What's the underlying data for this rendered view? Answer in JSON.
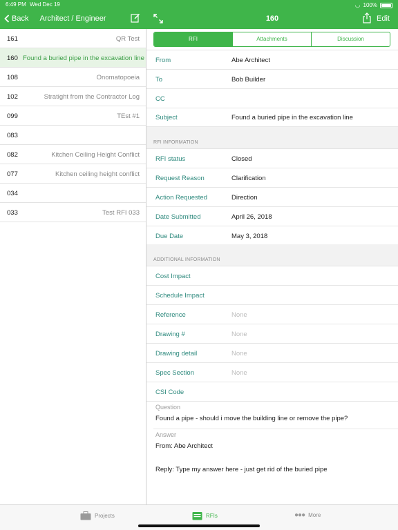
{
  "status_bar": {
    "time": "6:49 PM",
    "date": "Wed Dec 19",
    "battery": "100%"
  },
  "left_nav": {
    "back_label": "Back",
    "title": "Architect / Engineer"
  },
  "right_nav": {
    "title": "160",
    "edit_label": "Edit"
  },
  "rfi_list": [
    {
      "number": "161",
      "subject": "QR Test"
    },
    {
      "number": "160",
      "subject": "Found a buried pipe in the excavation line",
      "selected": true
    },
    {
      "number": "108",
      "subject": "Onomatopoeia"
    },
    {
      "number": "102",
      "subject": "Stratight from the Contractor Log"
    },
    {
      "number": "099",
      "subject": "TEst #1"
    },
    {
      "number": "083",
      "subject": ""
    },
    {
      "number": "082",
      "subject": "Kitchen Ceiling Height Conflict"
    },
    {
      "number": "077",
      "subject": "Kitchen ceiling height conflict"
    },
    {
      "number": "034",
      "subject": ""
    },
    {
      "number": "033",
      "subject": "Test RFI 033"
    }
  ],
  "segments": [
    {
      "label": "RFI",
      "active": true
    },
    {
      "label": "Attachments",
      "active": false
    },
    {
      "label": "Discussion",
      "active": false
    }
  ],
  "header_fields": [
    {
      "label": "From",
      "value": "Abe Architect"
    },
    {
      "label": "To",
      "value": "Bob Builder"
    },
    {
      "label": "CC",
      "value": ""
    },
    {
      "label": "Subject",
      "value": "Found a buried pipe in the excavation line"
    }
  ],
  "rfi_information": {
    "title": "RFI INFORMATION",
    "fields": [
      {
        "label": "RFI status",
        "value": "Closed"
      },
      {
        "label": "Request Reason",
        "value": "Clarification"
      },
      {
        "label": "Action Requested",
        "value": "Direction"
      },
      {
        "label": "Date Submitted",
        "value": "April 26, 2018"
      },
      {
        "label": "Due Date",
        "value": "May 3, 2018"
      }
    ]
  },
  "additional_information": {
    "title": "ADDITIONAL INFORMATION",
    "fields": [
      {
        "label": "Cost Impact",
        "value": ""
      },
      {
        "label": "Schedule Impact",
        "value": ""
      },
      {
        "label": "Reference",
        "value": "None",
        "placeholder": true
      },
      {
        "label": "Drawing #",
        "value": "None",
        "placeholder": true
      },
      {
        "label": "Drawing detail",
        "value": "None",
        "placeholder": true
      },
      {
        "label": "Spec Section",
        "value": "None",
        "placeholder": true
      },
      {
        "label": "CSI Code",
        "value": ""
      }
    ]
  },
  "question": {
    "label": "Question",
    "text": "Found a pipe - should i move the building line or remove the pipe?"
  },
  "answer": {
    "label": "Answer",
    "from": "From: Abe Architect",
    "reply": "Reply: Type my answer here - just get rid of the buried pipe"
  },
  "tabbar": [
    {
      "label": "Projects",
      "icon": "briefcase-icon",
      "active": false
    },
    {
      "label": "RFIs",
      "icon": "rfi-folder-icon",
      "active": true
    },
    {
      "label": "More",
      "icon": "more-dots-icon",
      "active": false
    }
  ],
  "colors": {
    "accent": "#3fb54a",
    "label_teal": "#2f8a7e",
    "selected_row": "#e7f4e5"
  }
}
